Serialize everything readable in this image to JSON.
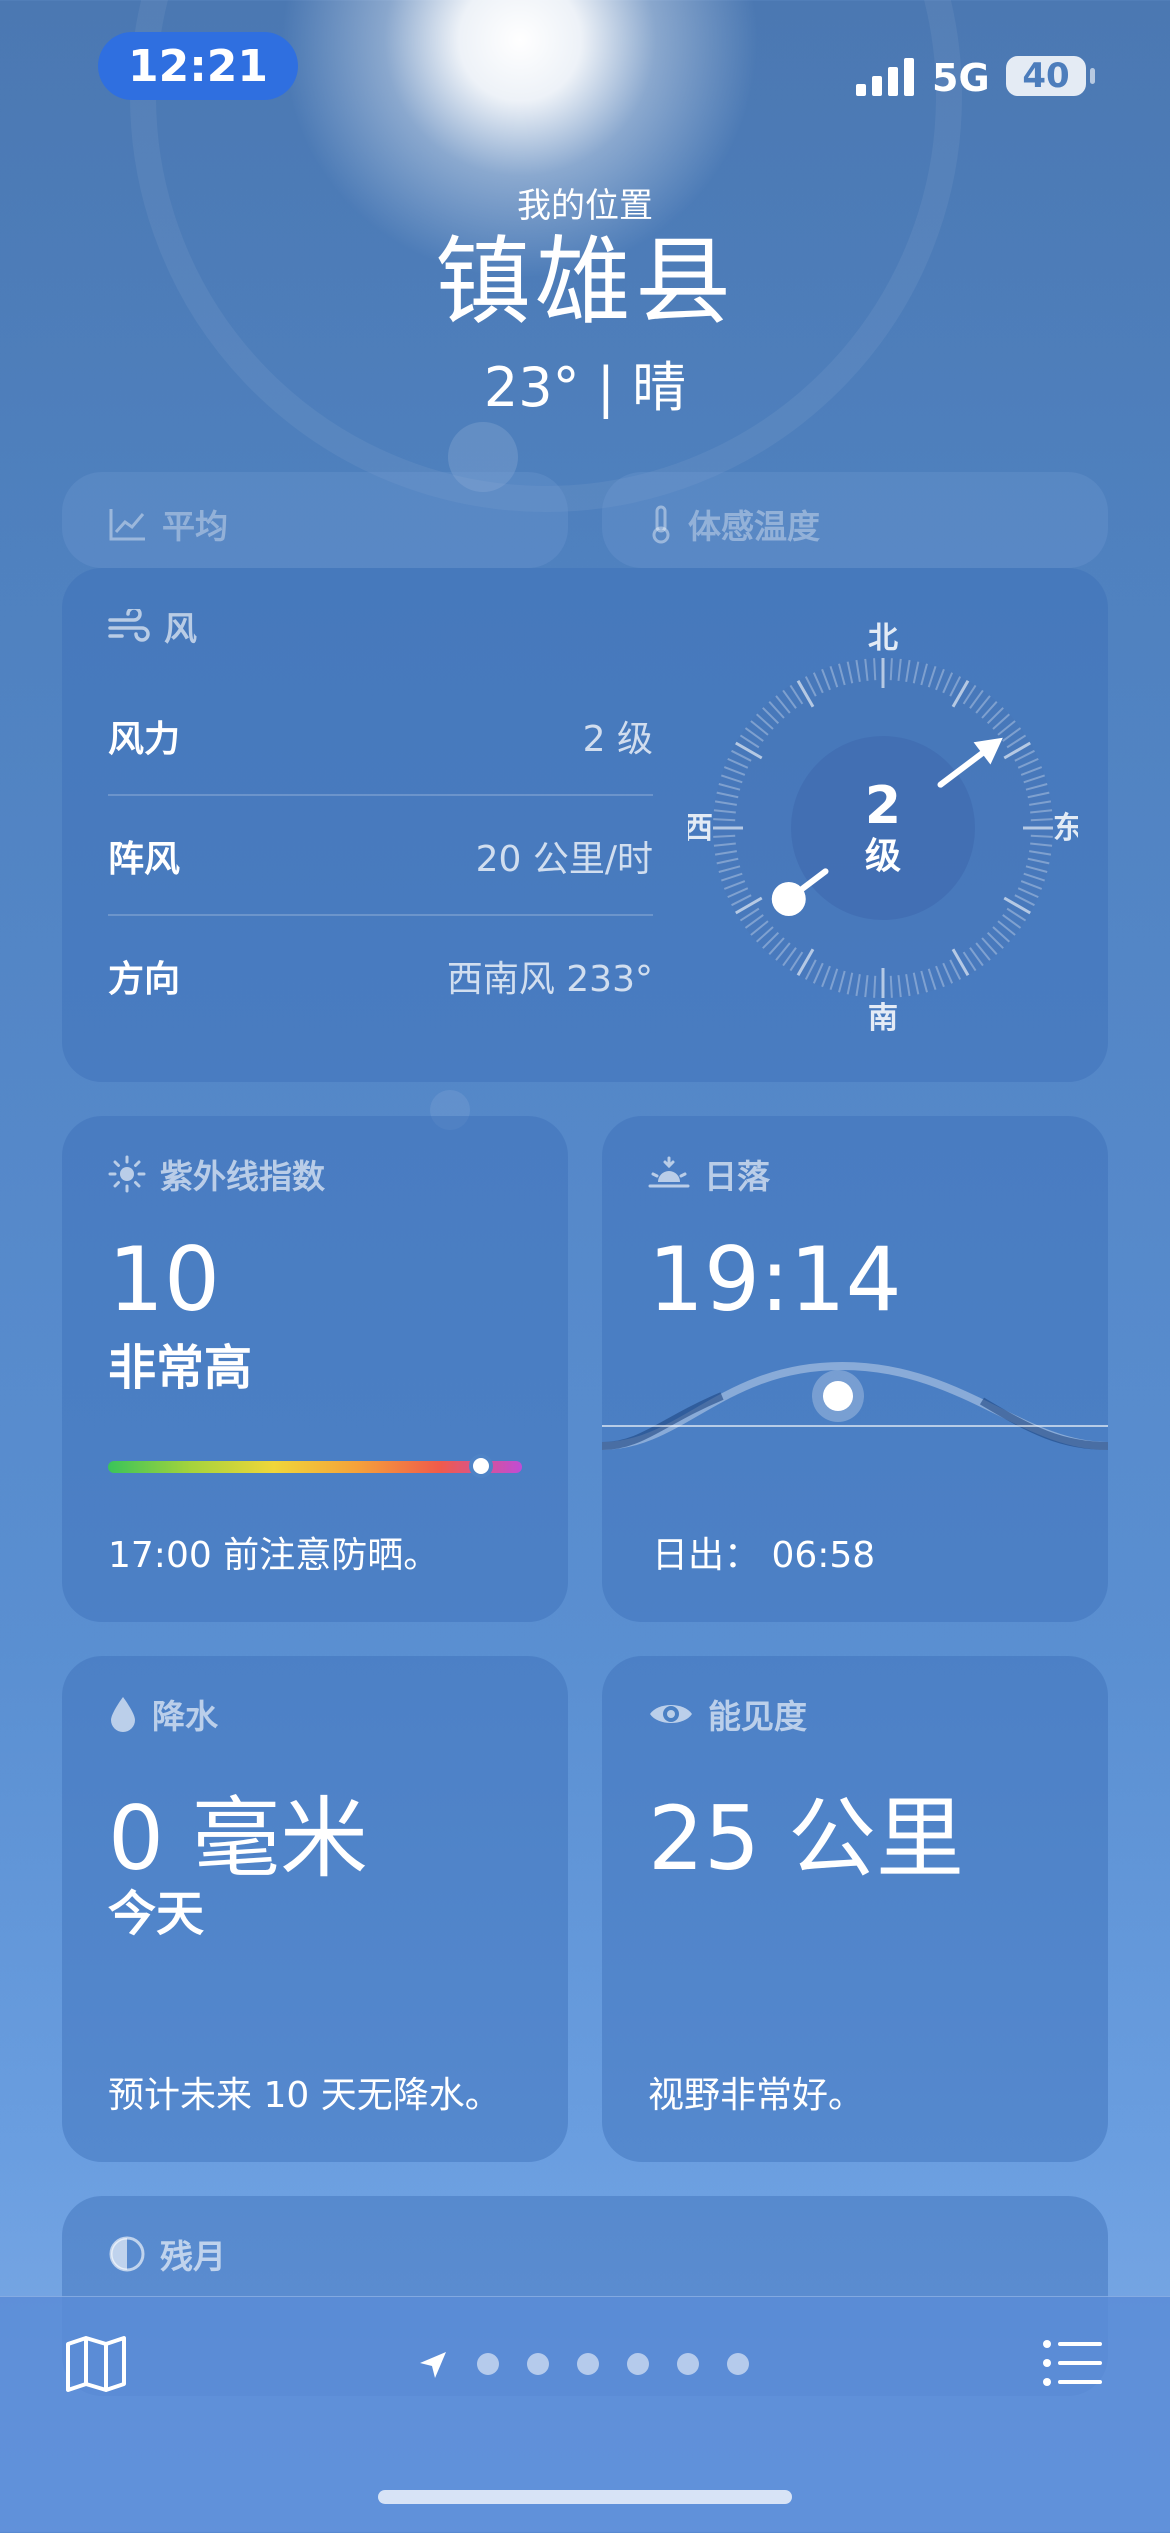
{
  "status": {
    "time": "12:21",
    "network": "5G",
    "battery": "40"
  },
  "header": {
    "my_location": "我的位置",
    "city": "镇雄县",
    "summary": "23° | 晴"
  },
  "peek_cards": {
    "average": "平均",
    "feels_like": "体感温度"
  },
  "wind": {
    "title": "风",
    "rows": [
      {
        "label": "风力",
        "value": "2 级"
      },
      {
        "label": "阵风",
        "value": "20 公里/时"
      },
      {
        "label": "方向",
        "value": "西南风 233°"
      }
    ],
    "compass": {
      "north": "北",
      "south": "南",
      "east": "东",
      "west": "西",
      "level": "2",
      "unit": "级",
      "direction_degrees": 233
    }
  },
  "uv": {
    "title": "紫外线指数",
    "value": "10",
    "level": "非常高",
    "note": "17:00 前注意防晒。",
    "position_fraction": 0.9
  },
  "sunset": {
    "title": "日落",
    "time": "19:14",
    "sunrise": "日出： 06:58"
  },
  "precipitation": {
    "title": "降水",
    "amount": "0 毫米",
    "period": "今天",
    "note": "预计未来 10 天无降水。"
  },
  "visibility": {
    "title": "能见度",
    "value": "25 公里",
    "note": "视野非常好。"
  },
  "moon": {
    "title": "残月"
  },
  "colors": {
    "accent": "#2f6fe0",
    "uv_gradient": [
      "#39c45a",
      "#f0d63a",
      "#f05b4a",
      "#c04cd6"
    ]
  }
}
